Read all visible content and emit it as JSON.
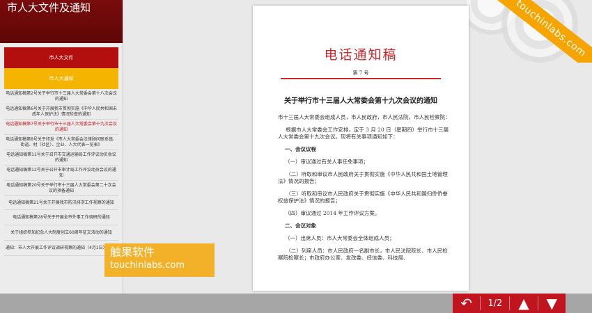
{
  "sidebar": {
    "title": "市人大文件及通知",
    "tabs": [
      {
        "label": "市人大文件",
        "color": "#b30f0f"
      },
      {
        "label": "市人大通知",
        "color": "#f4b400"
      }
    ],
    "items": [
      "电话通知稿第2号关于举行市十三届人大常委会第十八次会议的通知",
      "电话通知稿第6号关于开展我市贯彻实施《中华人民共和国未成年人保护法》情况检查的通知",
      "电话通知稿第7号关于举行市十三届人大常委会第十九次会议的通知",
      "电话通知稿第8号关于印发《市人大常委会法律顾问联系镇、街道、村（社区）、企业、人大代表一览表》",
      "电话通知稿第11号关于召开市交通运输局工作评议动员会议的通知",
      "电话通知稿第12号关于召开市审计局工作评议动员会议的通知",
      "电话通知稿第20号关于举行市十三届人大常委会第二十次会议的预备通知",
      "电话通知稿第21号关于开展我市防汛排涝工作视察的通知",
      "电话通知稿第28号关于开展全市外事工作调研的通知",
      "关于组织参加纪念人大制度创立60周年征文活动的通知",
      "通知：市人大开展工作评议调研视察的通知（4月1日）"
    ],
    "active_index": 2
  },
  "document": {
    "title": "电话通知稿",
    "number": "第 7 号",
    "subject": "关于举行市十三届人大常委会第十九次会议的通知",
    "paragraphs": [
      "市十三届人大常委会组成人员，市人民政府，市人民法院，市人民检察院：",
      "根据市人大常委会工作安排，定于 3 月 20 日（星期四）举行市十三届人大常委会第十九次会议。现将有关事项通知如下：",
      "一、会议议程",
      "（一）审议通过有关人事任免事项；",
      "（二）听取和审议市人民政府关于贯彻实施《中华人民共和国土地管理法》情况的报告；",
      "（三）听取和审议市人民政府关于贯彻实施《中华人民共和国归侨侨眷权益保护法》情况的报告；",
      "（四）审议通过 2014 年工作评议方案。",
      "二、会议对象",
      "（一）出席人员：市人大常委会全体组成人员；",
      "（二）列席人员：市人民政府一名副市长，市人民法院院长、市人民检察院检察长；市政府办公室、发改委、经信委、科技局、"
    ]
  },
  "watermark": {
    "cn": "触果软件",
    "en": "touchinlabs.com"
  },
  "corner_ribbon": "touchinlabs.com",
  "pager": {
    "page_display": "1/2"
  },
  "colors": {
    "brand_red": "#c0141e",
    "brand_yellow": "#f4b400",
    "header_dark_red": "#6e0909"
  }
}
